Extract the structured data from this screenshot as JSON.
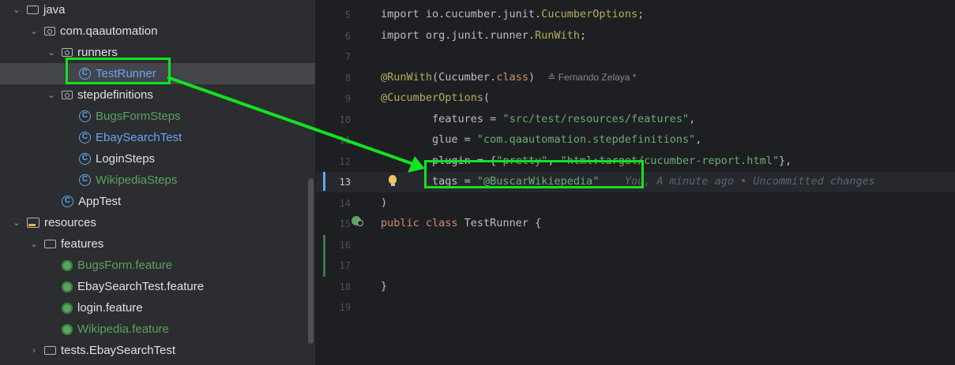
{
  "tree": {
    "items": [
      {
        "label": "java",
        "chevron": "down",
        "icon": "folder-icon",
        "indent": 0
      },
      {
        "label": "com.qaautomation",
        "chevron": "down",
        "icon": "package-icon",
        "indent": 1
      },
      {
        "label": "runners",
        "chevron": "down",
        "icon": "package-icon",
        "indent": 2
      },
      {
        "label": "TestRunner",
        "chevron": "",
        "icon": "test-class-icon",
        "indent": 3,
        "selected": true,
        "color": "blue"
      },
      {
        "label": "stepdefinitions",
        "chevron": "down",
        "icon": "package-icon",
        "indent": 2
      },
      {
        "label": "BugsFormSteps",
        "chevron": "",
        "icon": "class-icon",
        "indent": 3,
        "color": "green"
      },
      {
        "label": "EbaySearchTest",
        "chevron": "",
        "icon": "class-icon",
        "indent": 3,
        "color": "blue"
      },
      {
        "label": "LoginSteps",
        "chevron": "",
        "icon": "class-icon",
        "indent": 3,
        "color": "default"
      },
      {
        "label": "WikipediaSteps",
        "chevron": "",
        "icon": "class-icon",
        "indent": 3,
        "color": "green"
      },
      {
        "label": "AppTest",
        "chevron": "",
        "icon": "test-class-icon",
        "indent": 2,
        "color": "default"
      },
      {
        "label": "resources",
        "chevron": "down",
        "icon": "resources-folder-icon",
        "indent": 0
      },
      {
        "label": "features",
        "chevron": "down",
        "icon": "folder-icon",
        "indent": 1
      },
      {
        "label": "BugsForm.feature",
        "chevron": "",
        "icon": "cucumber-icon",
        "indent": 2,
        "color": "green"
      },
      {
        "label": "EbaySearchTest.feature",
        "chevron": "",
        "icon": "cucumber-icon",
        "indent": 2,
        "color": "default"
      },
      {
        "label": "login.feature",
        "chevron": "",
        "icon": "cucumber-icon",
        "indent": 2,
        "color": "default"
      },
      {
        "label": "Wikipedia.feature",
        "chevron": "",
        "icon": "cucumber-icon",
        "indent": 2,
        "color": "green"
      },
      {
        "label": "tests.EbaySearchTest",
        "chevron": "right",
        "icon": "folder-icon",
        "indent": 1
      }
    ]
  },
  "editor": {
    "current_line": "13",
    "lines": [
      {
        "n": "5",
        "parts": [
          {
            "t": "import io.cucumber.junit.",
            "c": ""
          },
          {
            "t": "CucumberOptions",
            "c": "ann"
          },
          {
            "t": ";",
            "c": ""
          }
        ]
      },
      {
        "n": "6",
        "parts": [
          {
            "t": "import org.junit.runner.",
            "c": ""
          },
          {
            "t": "RunWith",
            "c": "ann"
          },
          {
            "t": ";",
            "c": ""
          }
        ]
      },
      {
        "n": "7",
        "parts": []
      },
      {
        "n": "8",
        "parts": [
          {
            "t": "@RunWith",
            "c": "ann"
          },
          {
            "t": "(Cucumber.",
            "c": ""
          },
          {
            "t": "class",
            "c": "kw"
          },
          {
            "t": ")  ",
            "c": ""
          }
        ],
        "blame": "≗ Fernando Zelaya *"
      },
      {
        "n": "9",
        "parts": [
          {
            "t": "@CucumberOptions",
            "c": "ann"
          },
          {
            "t": "(",
            "c": ""
          }
        ]
      },
      {
        "n": "10",
        "parts": [
          {
            "t": "        features = ",
            "c": ""
          },
          {
            "t": "\"src/test/resources/features\"",
            "c": "str"
          },
          {
            "t": ",",
            "c": ""
          }
        ]
      },
      {
        "n": "11",
        "parts": [
          {
            "t": "        glue = ",
            "c": ""
          },
          {
            "t": "\"com.qaautomation.stepdefinitions\"",
            "c": "str"
          },
          {
            "t": ",",
            "c": ""
          }
        ]
      },
      {
        "n": "12",
        "parts": [
          {
            "t": "        plugin = {",
            "c": ""
          },
          {
            "t": "\"pretty\"",
            "c": "str"
          },
          {
            "t": ", ",
            "c": ""
          },
          {
            "t": "\"html:target/cucumber-report.html\"",
            "c": "str"
          },
          {
            "t": "},",
            "c": ""
          }
        ]
      },
      {
        "n": "13",
        "parts": [
          {
            "t": "        tags = ",
            "c": ""
          },
          {
            "t": "\"@BuscarWikiepedia\"",
            "c": "str"
          }
        ],
        "hint": "You, A minute ago • Uncommitted changes"
      },
      {
        "n": "14",
        "parts": [
          {
            "t": ")",
            "c": ""
          }
        ]
      },
      {
        "n": "15",
        "parts": [
          {
            "t": "public class ",
            "c": "kw"
          },
          {
            "t": "TestRunner {",
            "c": ""
          }
        ]
      },
      {
        "n": "16",
        "parts": []
      },
      {
        "n": "17",
        "parts": []
      },
      {
        "n": "18",
        "parts": [
          {
            "t": "}",
            "c": ""
          }
        ]
      },
      {
        "n": "19",
        "parts": []
      }
    ]
  },
  "colors": {
    "highlight": "#12e31f",
    "selection": "#43454a",
    "tree_bg": "#2b2d30",
    "editor_bg": "#1e1f22"
  }
}
